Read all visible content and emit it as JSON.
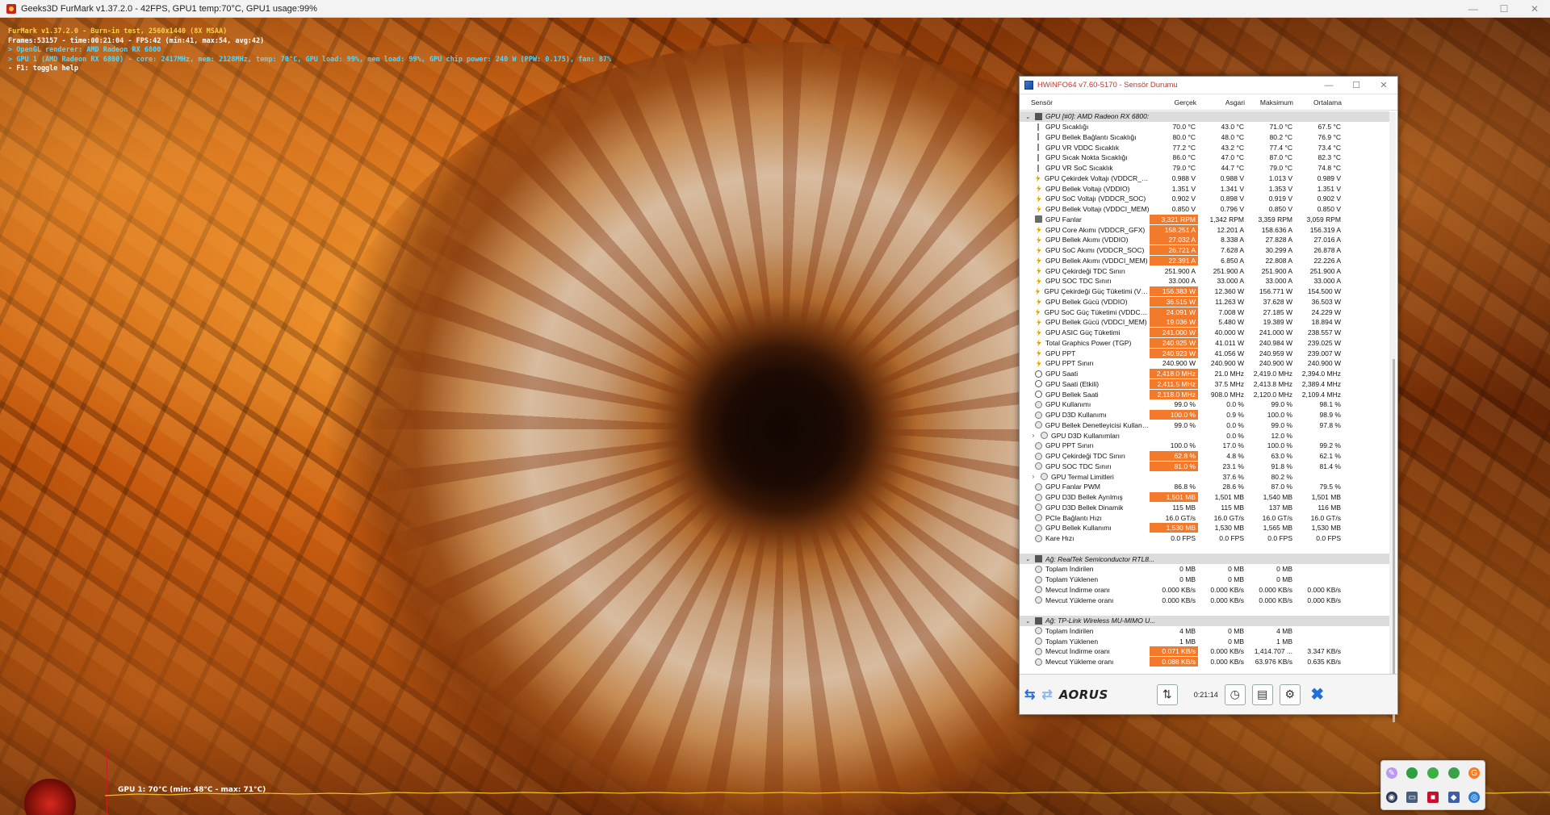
{
  "furmark": {
    "title": "Geeks3D FurMark v1.37.2.0 - 42FPS, GPU1 temp:70°C, GPU1 usage:99%",
    "osd": {
      "line1": "FurMark v1.37.2.0 - Burn-in test, 2560x1440 (8X MSAA)",
      "line2": "Frames:53157 - time:00:21:04 - FPS:42 (min:41, max:54, avg:42)",
      "line3": "> OpenGL renderer: AMD Radeon RX 6800",
      "line4": "> GPU 1 (AMD Radeon RX 6800) - core: 2417MHz, mem: 2128MHz, temp: 70°C, GPU load: 99%, mem load: 99%, GPU chip power: 240 W (PPW: 0.175), fan: 87%",
      "line5": "- F1: toggle help"
    },
    "graph_label": "GPU 1: 70°C (min: 48°C - max: 71°C)"
  },
  "hwinfo": {
    "title": "HWiNFO64 v7.60-5170 - Sensör Durumu",
    "headers": [
      "Sensör",
      "Gerçek",
      "Asgari",
      "Maksimum",
      "Ortalama"
    ],
    "colors": {
      "highlight": "#f37a2a",
      "section_bg": "#dcdcdc",
      "title_text": "#c0392b"
    },
    "sections": [
      {
        "title": "GPU [#0]: AMD Radeon RX 6800:",
        "rows": [
          {
            "icon": "temp",
            "name": "GPU Sıcaklığı",
            "cur": "70.0 °C",
            "min": "43.0 °C",
            "max": "71.0 °C",
            "avg": "67.5 °C",
            "hi": false
          },
          {
            "icon": "temp",
            "name": "GPU Bellek Bağlantı Sıcaklığı",
            "cur": "80.0 °C",
            "min": "48.0 °C",
            "max": "80.2 °C",
            "avg": "76.9 °C",
            "hi": false
          },
          {
            "icon": "temp",
            "name": "GPU VR VDDC Sıcaklık",
            "cur": "77.2 °C",
            "min": "43.2 °C",
            "max": "77.4 °C",
            "avg": "73.4 °C",
            "hi": false
          },
          {
            "icon": "temp",
            "name": "GPU Sıcak Nokta Sıcaklığı",
            "cur": "86.0 °C",
            "min": "47.0 °C",
            "max": "87.0 °C",
            "avg": "82.3 °C",
            "hi": false
          },
          {
            "icon": "temp",
            "name": "GPU VR SoC Sıcaklık",
            "cur": "79.0 °C",
            "min": "44.7 °C",
            "max": "79.0 °C",
            "avg": "74.8 °C",
            "hi": false
          },
          {
            "icon": "volt",
            "name": "GPU Çekirdek Voltajı (VDDCR_GFX)",
            "cur": "0.988 V",
            "min": "0.988 V",
            "max": "1.013 V",
            "avg": "0.989 V",
            "hi": false
          },
          {
            "icon": "volt",
            "name": "GPU Bellek Voltajı (VDDIO)",
            "cur": "1.351 V",
            "min": "1.341 V",
            "max": "1.353 V",
            "avg": "1.351 V",
            "hi": false
          },
          {
            "icon": "volt",
            "name": "GPU SoC Voltajı (VDDCR_SOC)",
            "cur": "0.902 V",
            "min": "0.898 V",
            "max": "0.919 V",
            "avg": "0.902 V",
            "hi": false
          },
          {
            "icon": "volt",
            "name": "GPU Bellek Voltajı (VDDCI_MEM)",
            "cur": "0.850 V",
            "min": "0.796 V",
            "max": "0.850 V",
            "avg": "0.850 V",
            "hi": false
          },
          {
            "icon": "fan",
            "name": "GPU Fanlar",
            "cur": "3,321 RPM",
            "min": "1,342 RPM",
            "max": "3,359 RPM",
            "avg": "3,059 RPM",
            "hi": true
          },
          {
            "icon": "volt",
            "name": "GPU Core Akımı (VDDCR_GFX)",
            "cur": "158.251 A",
            "min": "12.201 A",
            "max": "158.636 A",
            "avg": "156.319 A",
            "hi": true
          },
          {
            "icon": "volt",
            "name": "GPU Bellek Akımı (VDDIO)",
            "cur": "27.032 A",
            "min": "8.338 A",
            "max": "27.828 A",
            "avg": "27.016 A",
            "hi": true
          },
          {
            "icon": "volt",
            "name": "GPU SoC Akımı (VDDCR_SOC)",
            "cur": "26.721 A",
            "min": "7.628 A",
            "max": "30.299 A",
            "avg": "26.878 A",
            "hi": true
          },
          {
            "icon": "volt",
            "name": "GPU Bellek Akımı (VDDCI_MEM)",
            "cur": "22.391 A",
            "min": "6.850 A",
            "max": "22.808 A",
            "avg": "22.226 A",
            "hi": true
          },
          {
            "icon": "volt",
            "name": "GPU Çekirdeği TDC Sınırı",
            "cur": "251.900 A",
            "min": "251.900 A",
            "max": "251.900 A",
            "avg": "251.900 A",
            "hi": false
          },
          {
            "icon": "volt",
            "name": "GPU SOC TDC Sınırı",
            "cur": "33.000 A",
            "min": "33.000 A",
            "max": "33.000 A",
            "avg": "33.000 A",
            "hi": false
          },
          {
            "icon": "volt",
            "name": "GPU Çekirdeği Güç Tüketimi (VDDC...",
            "cur": "156.383 W",
            "min": "12.360 W",
            "max": "156.771 W",
            "avg": "154.500 W",
            "hi": true
          },
          {
            "icon": "volt",
            "name": "GPU Bellek Gücü (VDDIO)",
            "cur": "36.515 W",
            "min": "11.263 W",
            "max": "37.628 W",
            "avg": "36.503 W",
            "hi": true
          },
          {
            "icon": "volt",
            "name": "GPU SoC Güç Tüketimi (VDDCR_S...",
            "cur": "24.091 W",
            "min": "7.008 W",
            "max": "27.185 W",
            "avg": "24.229 W",
            "hi": true
          },
          {
            "icon": "volt",
            "name": "GPU Bellek Gücü (VDDCI_MEM)",
            "cur": "19.036 W",
            "min": "5.480 W",
            "max": "19.389 W",
            "avg": "18.894 W",
            "hi": true
          },
          {
            "icon": "volt",
            "name": "GPU ASIC Güç Tüketimi",
            "cur": "241.000 W",
            "min": "40.000 W",
            "max": "241.000 W",
            "avg": "238.557 W",
            "hi": true
          },
          {
            "icon": "volt",
            "name": "Total Graphics Power (TGP)",
            "cur": "240.925 W",
            "min": "41.011 W",
            "max": "240.984 W",
            "avg": "239.025 W",
            "hi": true
          },
          {
            "icon": "volt",
            "name": "GPU PPT",
            "cur": "240.923 W",
            "min": "41.056 W",
            "max": "240.959 W",
            "avg": "239.007 W",
            "hi": true
          },
          {
            "icon": "volt",
            "name": "GPU PPT Sınırı",
            "cur": "240.900 W",
            "min": "240.900 W",
            "max": "240.900 W",
            "avg": "240.900 W",
            "hi": false
          },
          {
            "icon": "clock",
            "name": "GPU Saati",
            "cur": "2,418.0 MHz",
            "min": "21.0 MHz",
            "max": "2,419.0 MHz",
            "avg": "2,394.0 MHz",
            "hi": true
          },
          {
            "icon": "clock",
            "name": "GPU Saati (Etkili)",
            "cur": "2,411.5 MHz",
            "min": "37.5 MHz",
            "max": "2,413.8 MHz",
            "avg": "2,389.4 MHz",
            "hi": true
          },
          {
            "icon": "clock",
            "name": "GPU Bellek Saati",
            "cur": "2,118.0 MHz",
            "min": "908.0 MHz",
            "max": "2,120.0 MHz",
            "avg": "2,109.4 MHz",
            "hi": true
          },
          {
            "icon": "gray",
            "name": "GPU Kullanımı",
            "cur": "99.0 %",
            "min": "0.0 %",
            "max": "99.0 %",
            "avg": "98.1 %",
            "hi": false
          },
          {
            "icon": "gray",
            "name": "GPU D3D Kullanımı",
            "cur": "100.0 %",
            "min": "0.9 %",
            "max": "100.0 %",
            "avg": "98.9 %",
            "hi": true
          },
          {
            "icon": "gray",
            "name": "GPU Bellek Denetleyicisi Kullanımı",
            "cur": "99.0 %",
            "min": "0.0 %",
            "max": "99.0 %",
            "avg": "97.8 %",
            "hi": false
          },
          {
            "icon": "gray",
            "name": "GPU D3D Kullanımları",
            "cur": "",
            "min": "0.0 %",
            "max": "12.0 %",
            "avg": "",
            "hi": false,
            "sub": true
          },
          {
            "icon": "gray",
            "name": "GPU PPT Sınırı",
            "cur": "100.0 %",
            "min": "17.0 %",
            "max": "100.0 %",
            "avg": "99.2 %",
            "hi": false
          },
          {
            "icon": "gray",
            "name": "GPU Çekirdeği TDC Sınırı",
            "cur": "62.8 %",
            "min": "4.8 %",
            "max": "63.0 %",
            "avg": "62.1 %",
            "hi": true
          },
          {
            "icon": "gray",
            "name": "GPU SOC TDC Sınırı",
            "cur": "81.0 %",
            "min": "23.1 %",
            "max": "91.8 %",
            "avg": "81.4 %",
            "hi": true
          },
          {
            "icon": "gray",
            "name": "GPU Termal Limitleri",
            "cur": "",
            "min": "37.6 %",
            "max": "80.2 %",
            "avg": "",
            "hi": false,
            "sub": true
          },
          {
            "icon": "gray",
            "name": "GPU Fanlar PWM",
            "cur": "86.8 %",
            "min": "28.6 %",
            "max": "87.0 %",
            "avg": "79.5 %",
            "hi": false
          },
          {
            "icon": "gray",
            "name": "GPU D3D Bellek Ayrılmış",
            "cur": "1,501 MB",
            "min": "1,501 MB",
            "max": "1,540 MB",
            "avg": "1,501 MB",
            "hi": true
          },
          {
            "icon": "gray",
            "name": "GPU D3D Bellek Dinamik",
            "cur": "115 MB",
            "min": "115 MB",
            "max": "137 MB",
            "avg": "116 MB",
            "hi": false
          },
          {
            "icon": "gray",
            "name": "PCIe Bağlantı Hızı",
            "cur": "16.0 GT/s",
            "min": "16.0 GT/s",
            "max": "16.0 GT/s",
            "avg": "16.0 GT/s",
            "hi": false
          },
          {
            "icon": "gray",
            "name": "GPU Bellek Kullanımı",
            "cur": "1,530 MB",
            "min": "1,530 MB",
            "max": "1,565 MB",
            "avg": "1,530 MB",
            "hi": true
          },
          {
            "icon": "gray",
            "name": "Kare Hızı",
            "cur": "0.0 FPS",
            "min": "0.0 FPS",
            "max": "0.0 FPS",
            "avg": "0.0 FPS",
            "hi": false
          }
        ]
      },
      {
        "title": "Ağ: RealTek Semiconductor RTL8...",
        "rows": [
          {
            "icon": "gray",
            "name": "Toplam İndirilen",
            "cur": "0 MB",
            "min": "0 MB",
            "max": "0 MB",
            "avg": "",
            "hi": false
          },
          {
            "icon": "gray",
            "name": "Toplam Yüklenen",
            "cur": "0 MB",
            "min": "0 MB",
            "max": "0 MB",
            "avg": "",
            "hi": false
          },
          {
            "icon": "gray",
            "name": "Mevcut İndirme oranı",
            "cur": "0.000 KB/s",
            "min": "0.000 KB/s",
            "max": "0.000 KB/s",
            "avg": "0.000 KB/s",
            "hi": false
          },
          {
            "icon": "gray",
            "name": "Mevcut Yükleme oranı",
            "cur": "0.000 KB/s",
            "min": "0.000 KB/s",
            "max": "0.000 KB/s",
            "avg": "0.000 KB/s",
            "hi": false
          }
        ]
      },
      {
        "title": "Ağ: TP-Link Wireless MU-MIMO U...",
        "rows": [
          {
            "icon": "gray",
            "name": "Toplam İndirilen",
            "cur": "4 MB",
            "min": "0 MB",
            "max": "4 MB",
            "avg": "",
            "hi": false
          },
          {
            "icon": "gray",
            "name": "Toplam Yüklenen",
            "cur": "1 MB",
            "min": "0 MB",
            "max": "1 MB",
            "avg": "",
            "hi": false
          },
          {
            "icon": "gray",
            "name": "Mevcut İndirme oranı",
            "cur": "0.071 KB/s",
            "min": "0.000 KB/s",
            "max": "1,414.707 ...",
            "avg": "3.347 KB/s",
            "hi": true
          },
          {
            "icon": "gray",
            "name": "Mevcut Yükleme oranı",
            "cur": "0.088 KB/s",
            "min": "0.000 KB/s",
            "max": "63.976 KB/s",
            "avg": "0.635 KB/s",
            "hi": true
          }
        ]
      }
    ],
    "toolbar": {
      "brand": "AORUS",
      "timer": "0:21:14"
    }
  }
}
